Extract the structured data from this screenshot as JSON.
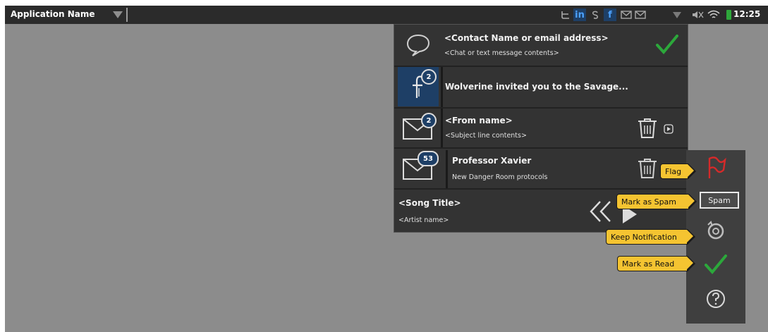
{
  "status_bar": {
    "app_name": "Application Name",
    "icons": [
      {
        "name": "twitter-icon",
        "glyph": "ᥤ"
      },
      {
        "name": "linkedin-icon",
        "glyph": "in"
      },
      {
        "name": "skype-icon",
        "glyph": "ꗯ"
      },
      {
        "name": "facebook-icon",
        "glyph": "f"
      },
      {
        "name": "mail-icon",
        "glyph": "✉"
      },
      {
        "name": "mail-icon-2",
        "glyph": "✉"
      }
    ],
    "mute_icon": "🔇",
    "wifi_icon": "≋",
    "time": "12:25",
    "colors": {
      "bar": "#2b2b2b",
      "highlight": "#1e3f66",
      "battery": "#2ea83b"
    }
  },
  "notifications": [
    {
      "type": "chat",
      "title": "<Contact Name or email address>",
      "subtitle": "<Chat or text message contents>",
      "icon": "speech-bubble-icon",
      "action_icon": "checkmark-icon"
    },
    {
      "type": "facebook",
      "title": "Wolverine invited you to the Savage...",
      "icon": "facebook-icon",
      "badge": "2"
    },
    {
      "type": "email",
      "title": "<From name>",
      "subtitle": "<Subject line contents>",
      "icon": "envelope-icon",
      "badge": "2",
      "action_icons": [
        "trash-icon",
        "play-icon"
      ]
    },
    {
      "type": "email",
      "title": "Professor Xavier",
      "subtitle": "New Danger Room protocols",
      "icon": "envelope-icon",
      "badge": "53",
      "action_icons": [
        "trash-icon"
      ]
    },
    {
      "type": "music",
      "title": "<Song Title>",
      "subtitle": "<Artist name>",
      "controls": [
        "rewind-icon",
        "play-icon",
        "fast-forward-icon"
      ]
    }
  ],
  "side_actions": {
    "spam_label": "Spam",
    "callouts": {
      "flag": "Flag",
      "spam": "Mark as Spam",
      "keep": "Keep Notification",
      "read": "Mark as Read"
    }
  },
  "accent_colors": {
    "green": "#2ca83b",
    "red": "#d52a2a",
    "callout": "#f5c431"
  }
}
